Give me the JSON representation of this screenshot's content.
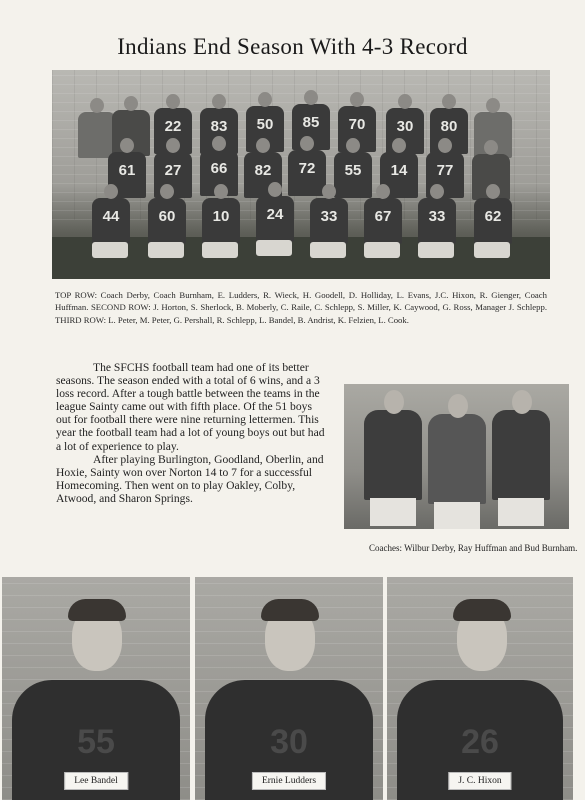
{
  "title": "Indians End Season With 4-3 Record",
  "team_photo": {
    "jerseys_back": [
      "22",
      "83",
      "50",
      "85",
      "70",
      "30",
      "80"
    ],
    "jerseys_middle": [
      "61",
      "27",
      "66",
      "82",
      "72",
      "55",
      "14",
      "77"
    ],
    "jerseys_front": [
      "44",
      "60",
      "10",
      "24",
      "33",
      "67",
      "33",
      "62"
    ]
  },
  "caption": "TOP ROW: Coach Derby, Coach Burnham, E. Ludders, R. Wieck, H. Goodell, D. Holliday, L. Evans, J.C. Hixon, R. Gienger, Coach Huffman. SECOND ROW: J. Horton, S. Sherlock, B. Moberly, C. Raile, C. Schlepp, S. Miller, K. Caywood, G. Ross, Manager J. Schlepp. THIRD ROW: L. Peter, M. Peter, G. Pershall, R. Schlepp, L. Bandel, B. Andrist, K. Felzien, L. Cook.",
  "story": {
    "p1": "The SFCHS football team had one of its better seasons. The season ended with a total of 6 wins, and a 3 loss record. After a tough battle between the teams in the league Sainty came out with fifth place. Of the 51 boys out for football there were nine returning lettermen. This year the football team had a lot of young boys out but had a lot of experience to play.",
    "p2": "After playing Burlington, Goodland, Oberlin, and Hoxie, Sainty won over Norton 14 to 7 for a successful Homecoming. Then went on to play Oakley, Colby, Atwood, and Sharon Springs."
  },
  "coaches_caption": "Coaches: Wilbur Derby, Ray Huffman and Bud Burnham.",
  "portraits": [
    {
      "name": "Lee Bandel",
      "number": "55"
    },
    {
      "name": "Ernie Ludders",
      "number": "30"
    },
    {
      "name": "J. C. Hixon",
      "number": "26"
    }
  ]
}
